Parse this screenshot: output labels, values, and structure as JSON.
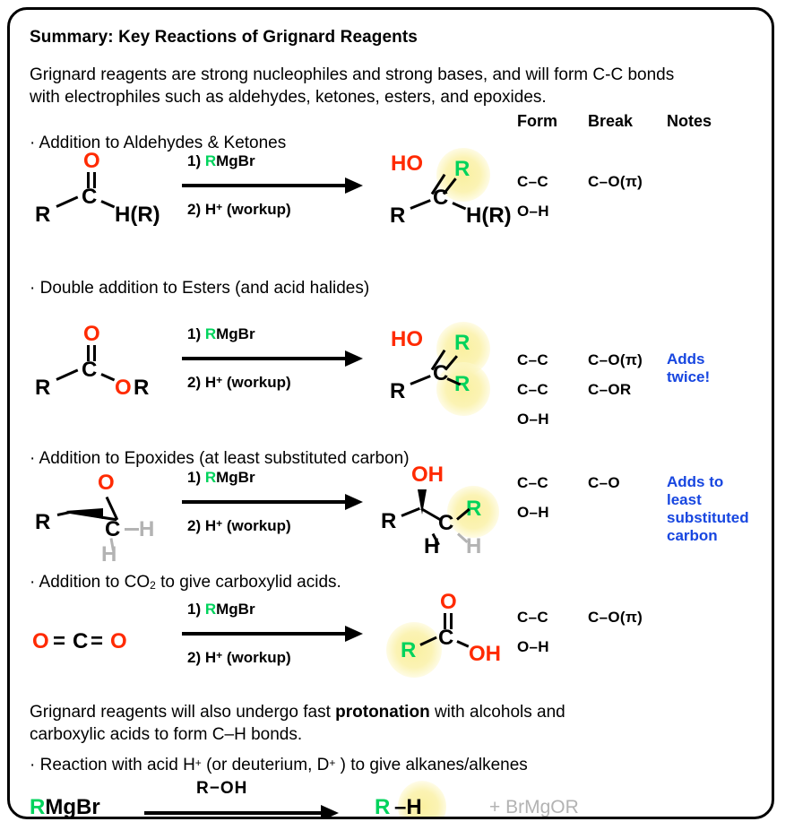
{
  "card": {
    "title": "Summary: Key Reactions of Grignard Reagents",
    "intro_line1": "Grignard reagents are strong nucleophiles and strong bases, and will form C-C bonds",
    "intro_line2": "with electrophiles such as aldehydes, ketones, esters, and epoxides."
  },
  "columns": {
    "form": "Form",
    "break": "Break",
    "notes": "Notes"
  },
  "reagents": {
    "step1_prefix": "1)",
    "step1_R": "R",
    "step1_rest": "MgBr",
    "step2_prefix": "2) H",
    "step2_sup": "+",
    "step2_rest": "(workup)"
  },
  "reactions": [
    {
      "heading": "· Addition to Aldehydes & Ketones",
      "start_atoms": {
        "O": "O",
        "C": "C",
        "R": "R",
        "HR": "H(R)"
      },
      "product_atoms": {
        "HO": "HO",
        "R_green": "R",
        "C": "C",
        "R": "R",
        "HR": "H(R)"
      },
      "form": [
        "C–C",
        "O–H"
      ],
      "break": [
        "C–O(π)"
      ],
      "notes": []
    },
    {
      "heading": "· Double addition to Esters (and acid halides)",
      "start_atoms": {
        "O": "O",
        "C": "C",
        "R": "R",
        "O2": "O",
        "R2": "R"
      },
      "product_atoms": {
        "HO": "HO",
        "R_green_top": "R",
        "R_green_bot": "R",
        "C": "C",
        "R": "R"
      },
      "form": [
        "C–C",
        "C–C",
        "O–H"
      ],
      "break": [
        "C–O(π)",
        "C–OR"
      ],
      "notes": [
        "Adds",
        "twice!"
      ]
    },
    {
      "heading": "· Addition to Epoxides (at least substituted carbon)",
      "start_atoms": {
        "O": "O",
        "C": "C",
        "R": "R",
        "H_right": "H",
        "H_bottom": "H"
      },
      "product_atoms": {
        "OH": "OH",
        "R": "R",
        "C": "C",
        "R_green": "R",
        "H_left": "H",
        "H_right": "H"
      },
      "form": [
        "C–C",
        "O–H"
      ],
      "break": [
        "C–O"
      ],
      "notes": [
        "Adds to",
        "least",
        "substituted",
        "carbon"
      ]
    },
    {
      "heading_pre": "· Addition to CO",
      "heading_sub": "2",
      "heading_post": " to give carboxylid acids.",
      "start_atoms": {
        "O_left": "O",
        "eq1": "=",
        "C": "C",
        "eq2": "=",
        "O_right": "O"
      },
      "product_atoms": {
        "O": "O",
        "C": "C",
        "R_green": "R",
        "OH": "OH"
      },
      "form": [
        "C–C",
        "O–H"
      ],
      "break": [
        "C–O(π)"
      ],
      "notes": []
    }
  ],
  "footer": {
    "para_a": "Grignard reagents will also undergo fast ",
    "para_bold": "protonation",
    "para_b": " with alcohols and",
    "para_line2": "carboxylic acids to form C–H bonds.",
    "bullet_pre": "· Reaction with acid H",
    "bullet_sup1": "+",
    "bullet_mid": " (or deuterium, D",
    "bullet_sup2": "+",
    "bullet_post": " ) to give alkanes/alkenes",
    "reactant_R": "R",
    "reactant_rest": "MgBr",
    "arrow_label": "R−OH",
    "product_R": "R",
    "product_rest": "–H",
    "byproduct": "+ BrMgOR"
  },
  "colors": {
    "red": "#ff2a00",
    "green": "#00d35c",
    "blue": "#1746e0",
    "grey": "#b3b3b3",
    "glow": "#faf0a0"
  }
}
